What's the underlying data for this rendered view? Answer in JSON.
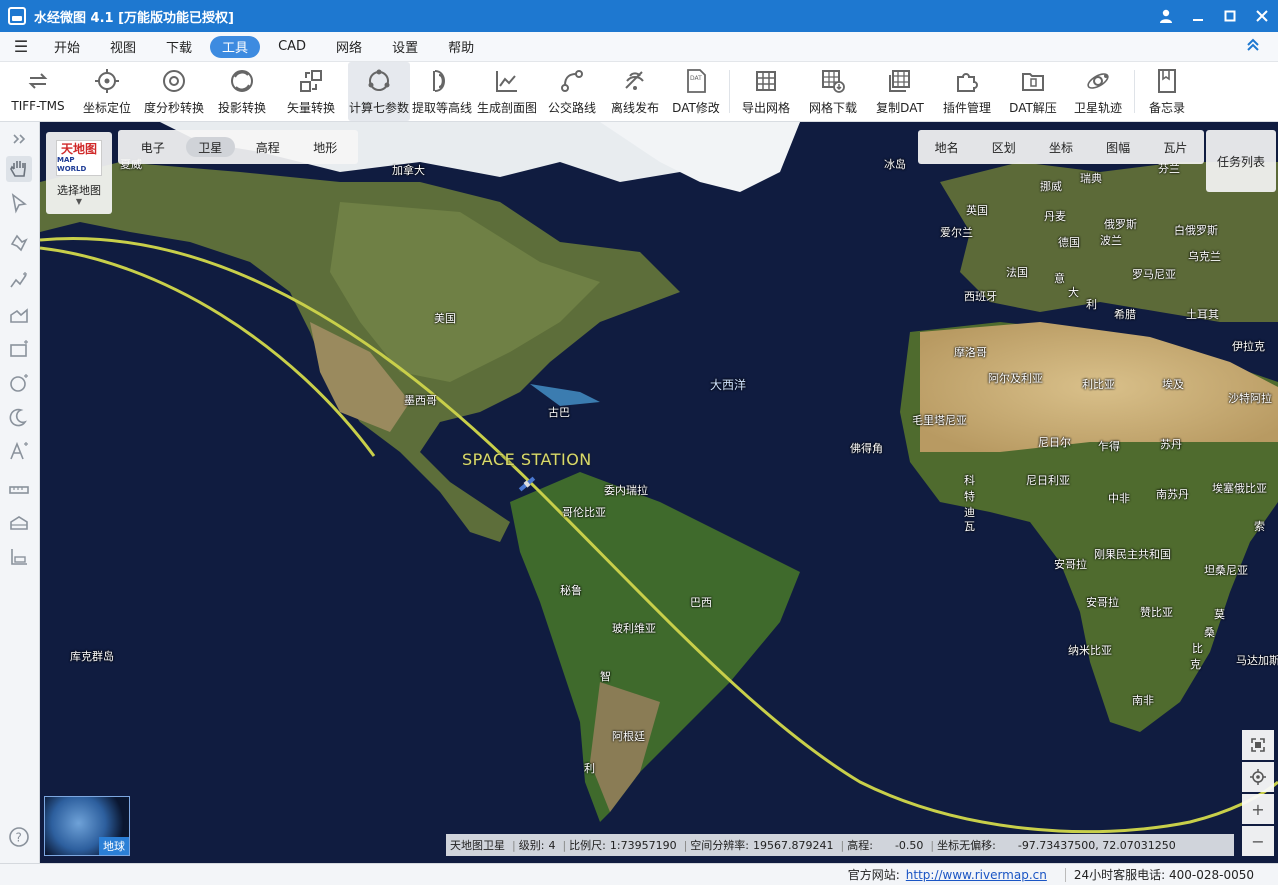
{
  "window": {
    "title": "水经微图 4.1 [万能版功能已授权]",
    "controls": [
      "user-icon",
      "minimize-icon",
      "maximize-icon",
      "close-icon"
    ]
  },
  "menu": {
    "items": [
      "开始",
      "视图",
      "下载",
      "工具",
      "CAD",
      "网络",
      "设置",
      "帮助"
    ],
    "active": "工具"
  },
  "toolbar": {
    "tools": [
      {
        "label": "TIFF-TMS",
        "icon": "convert-icon"
      },
      {
        "label": "坐标定位",
        "icon": "crosshair-icon"
      },
      {
        "label": "度分秒转换",
        "icon": "target-icon"
      },
      {
        "label": "投影转换",
        "icon": "projection-icon"
      },
      {
        "label": "矢量转换",
        "icon": "vector-convert-icon"
      },
      {
        "label": "计算七参数",
        "icon": "seven-params-icon"
      },
      {
        "label": "提取等高线",
        "icon": "contour-icon"
      },
      {
        "label": "生成剖面图",
        "icon": "profile-chart-icon"
      },
      {
        "label": "公交路线",
        "icon": "bus-route-icon"
      },
      {
        "label": "离线发布",
        "icon": "offline-publish-icon"
      },
      {
        "label": "DAT修改",
        "icon": "dat-edit-icon"
      },
      {
        "label": "导出网格",
        "icon": "grid-export-icon"
      },
      {
        "label": "网格下载",
        "icon": "grid-download-icon"
      },
      {
        "label": "复制DAT",
        "icon": "copy-dat-icon"
      },
      {
        "label": "插件管理",
        "icon": "plugin-icon"
      },
      {
        "label": "DAT解压",
        "icon": "dat-unzip-icon"
      },
      {
        "label": "卫星轨迹",
        "icon": "satellite-track-icon"
      },
      {
        "label": "备忘录",
        "icon": "memo-icon"
      }
    ],
    "active": "计算七参数"
  },
  "left_tools": [
    "expand-icon",
    "pan-hand-icon",
    "select-arrow-icon",
    "draw-point-icon",
    "draw-polyline-icon",
    "draw-area-icon",
    "draw-rectangle-icon",
    "draw-circle-icon",
    "draw-crescent-icon",
    "add-text-icon",
    "measure-distance-icon",
    "measure-area-icon",
    "measure-height-icon",
    "help-icon"
  ],
  "map": {
    "select_map_label": "选择地图",
    "logo_text": "天地图",
    "logo_subtext": "MAP WORLD",
    "map_types": [
      "电子",
      "卫星",
      "高程",
      "地形"
    ],
    "active_map_type": "卫星",
    "layers": [
      "地名",
      "区划",
      "坐标",
      "图幅",
      "瓦片"
    ],
    "task_list": "任务列表",
    "globe_label": "地球",
    "station_label": "SPACE STATION",
    "labels": {
      "canada": "加拿大",
      "iceland": "冰岛",
      "norway": "挪威",
      "sweden": "瑞典",
      "finland": "芬兰",
      "uk": "英国",
      "denmark": "丹麦",
      "ireland": "爱尔兰",
      "russia": "俄罗斯",
      "germany": "德国",
      "poland": "波兰",
      "belarus": "白俄罗斯",
      "ukraine": "乌克兰",
      "france": "法国",
      "italy1": "意",
      "italy2": "大",
      "italy3": "利",
      "romania": "罗马尼亚",
      "spain": "西班牙",
      "greece": "希腊",
      "turkey": "土耳其",
      "usa": "美国",
      "morocco": "摩洛哥",
      "algeria": "阿尔及利亚",
      "libya": "利比亚",
      "egypt": "埃及",
      "saudi": "沙特阿拉",
      "iran": "伊拉克",
      "mexico": "墨西哥",
      "cuba": "古巴",
      "atlantic": "大西洋",
      "mauritania": "毛里塔尼亚",
      "mali": "尼日尔",
      "chad": "乍得",
      "sudan": "苏丹",
      "capeverde": "佛得角",
      "cotedivoire1": "科",
      "cotedivoire2": "特",
      "cotedivoire3": "迪",
      "cotedivoire4": "瓦",
      "nigeria": "尼日利亚",
      "car": "中非",
      "south_sudan": "南苏丹",
      "ethiopia": "埃塞俄比亚",
      "somalia": "索",
      "venezuela": "委内瑞拉",
      "colombia": "哥伦比亚",
      "drc": "刚果民主共和国",
      "angola_n": "安哥拉",
      "tanzania": "坦桑尼亚",
      "peru": "秘鲁",
      "brazil": "巴西",
      "bolivia": "玻利维亚",
      "angola": "安哥拉",
      "zambia": "赞比亚",
      "mozambique1": "莫",
      "mozambique2": "桑",
      "mozambique3": "比",
      "mozambique4": "克",
      "madagascar": "马达加斯",
      "namibia": "纳米比亚",
      "chile1": "智",
      "chile2": "利",
      "argentina": "阿根廷",
      "south_africa": "南非",
      "cook": "库克群岛",
      "hawaii": "夏威"
    },
    "status": {
      "source": "天地图卫星",
      "level_label": "级别:",
      "level": "4",
      "scale_label": "比例尺:",
      "scale": "1:73957190",
      "resolution_label": "空间分辨率:",
      "resolution": "19567.879241",
      "elevation_label": "高程:",
      "elevation": "-0.50",
      "coord_label": "坐标无偏移:",
      "coord": "-97.73437500, 72.07031250"
    }
  },
  "statusbar": {
    "website_label": "官方网站:",
    "website": "http://www.rivermap.cn",
    "hotline": "24小时客服电话:  400-028-0050"
  },
  "colors": {
    "titlebar": "#1e78d0",
    "active_menu": "#3d8be0",
    "orbit": "#c8cf4a",
    "ocean": "#0f1a3c"
  }
}
